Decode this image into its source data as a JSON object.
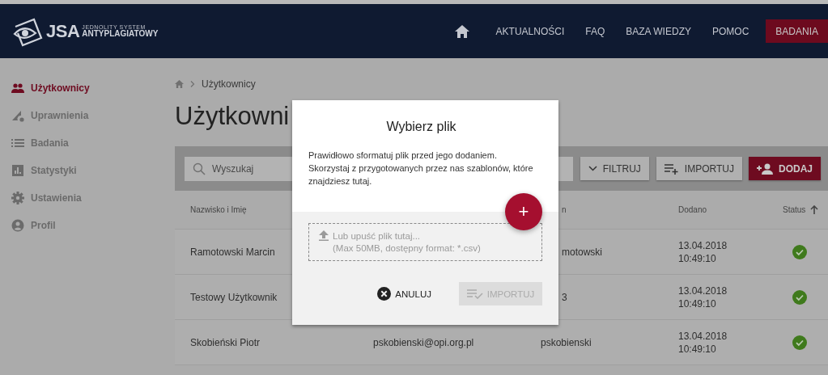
{
  "header": {
    "logo_short": "JSA",
    "logo_line1": "JEDNOLITY SYSTEM",
    "logo_line2": "ANTYPLAGIATOWY",
    "nav": [
      {
        "label": "AKTUALNOŚCI",
        "selected": false
      },
      {
        "label": "FAQ",
        "selected": false
      },
      {
        "label": "BAZA WIEDZY",
        "selected": false
      },
      {
        "label": "POMOC",
        "selected": false
      },
      {
        "label": "BADANIA",
        "selected": true
      }
    ]
  },
  "sidebar": {
    "items": [
      {
        "label": "Użytkownicy",
        "selected": true
      },
      {
        "label": "Uprawnienia",
        "selected": false
      },
      {
        "label": "Badania",
        "selected": false
      },
      {
        "label": "Statystyki",
        "selected": false
      },
      {
        "label": "Ustawienia",
        "selected": false
      },
      {
        "label": "Profil",
        "selected": false
      }
    ]
  },
  "breadcrumb": {
    "current": "Użytkownicy"
  },
  "page_title": "Użytkowni",
  "toolbar": {
    "search_placeholder": "Wyszukaj",
    "filter": "FILTRUJ",
    "import": "IMPORTUJ",
    "add": "DODAJ"
  },
  "table": {
    "columns": [
      {
        "label": "Nazwisko i Imię"
      },
      {
        "label": "n",
        "covered": true
      },
      {
        "label": "Dodano"
      },
      {
        "label": "Status",
        "sorted": true
      }
    ],
    "rows": [
      {
        "name": "Ramotowski Marcin",
        "login": "motowski",
        "login_covered": true,
        "date": "13.04.2018",
        "time": "10:49:10",
        "active": true
      },
      {
        "name": "Testowy Użytkownik",
        "login": "3",
        "login_covered": true,
        "date": "13.04.2018",
        "time": "10:49:10",
        "active": true
      },
      {
        "name": "Skobieński Piotr",
        "email": "pskobienski@opi.org.pl",
        "login": "pskobienski",
        "login_covered": false,
        "date": "13.04.2018",
        "time": "10:49:10",
        "active": true
      }
    ]
  },
  "dialog": {
    "title": "Wybierz plik",
    "description": "Prawidłowo sformatuj plik przed jego dodaniem. Skorzystaj z przygotowanych przez nas szablonów, które znajdziesz tutaj.",
    "drop_line1": "Lub upuść plik tutaj...",
    "drop_line2": "(Max 50MB, dostępny format: *.csv)",
    "add_symbol": "+",
    "cancel": "ANULUJ",
    "import": "IMPORTUJ",
    "import_disabled": true
  }
}
